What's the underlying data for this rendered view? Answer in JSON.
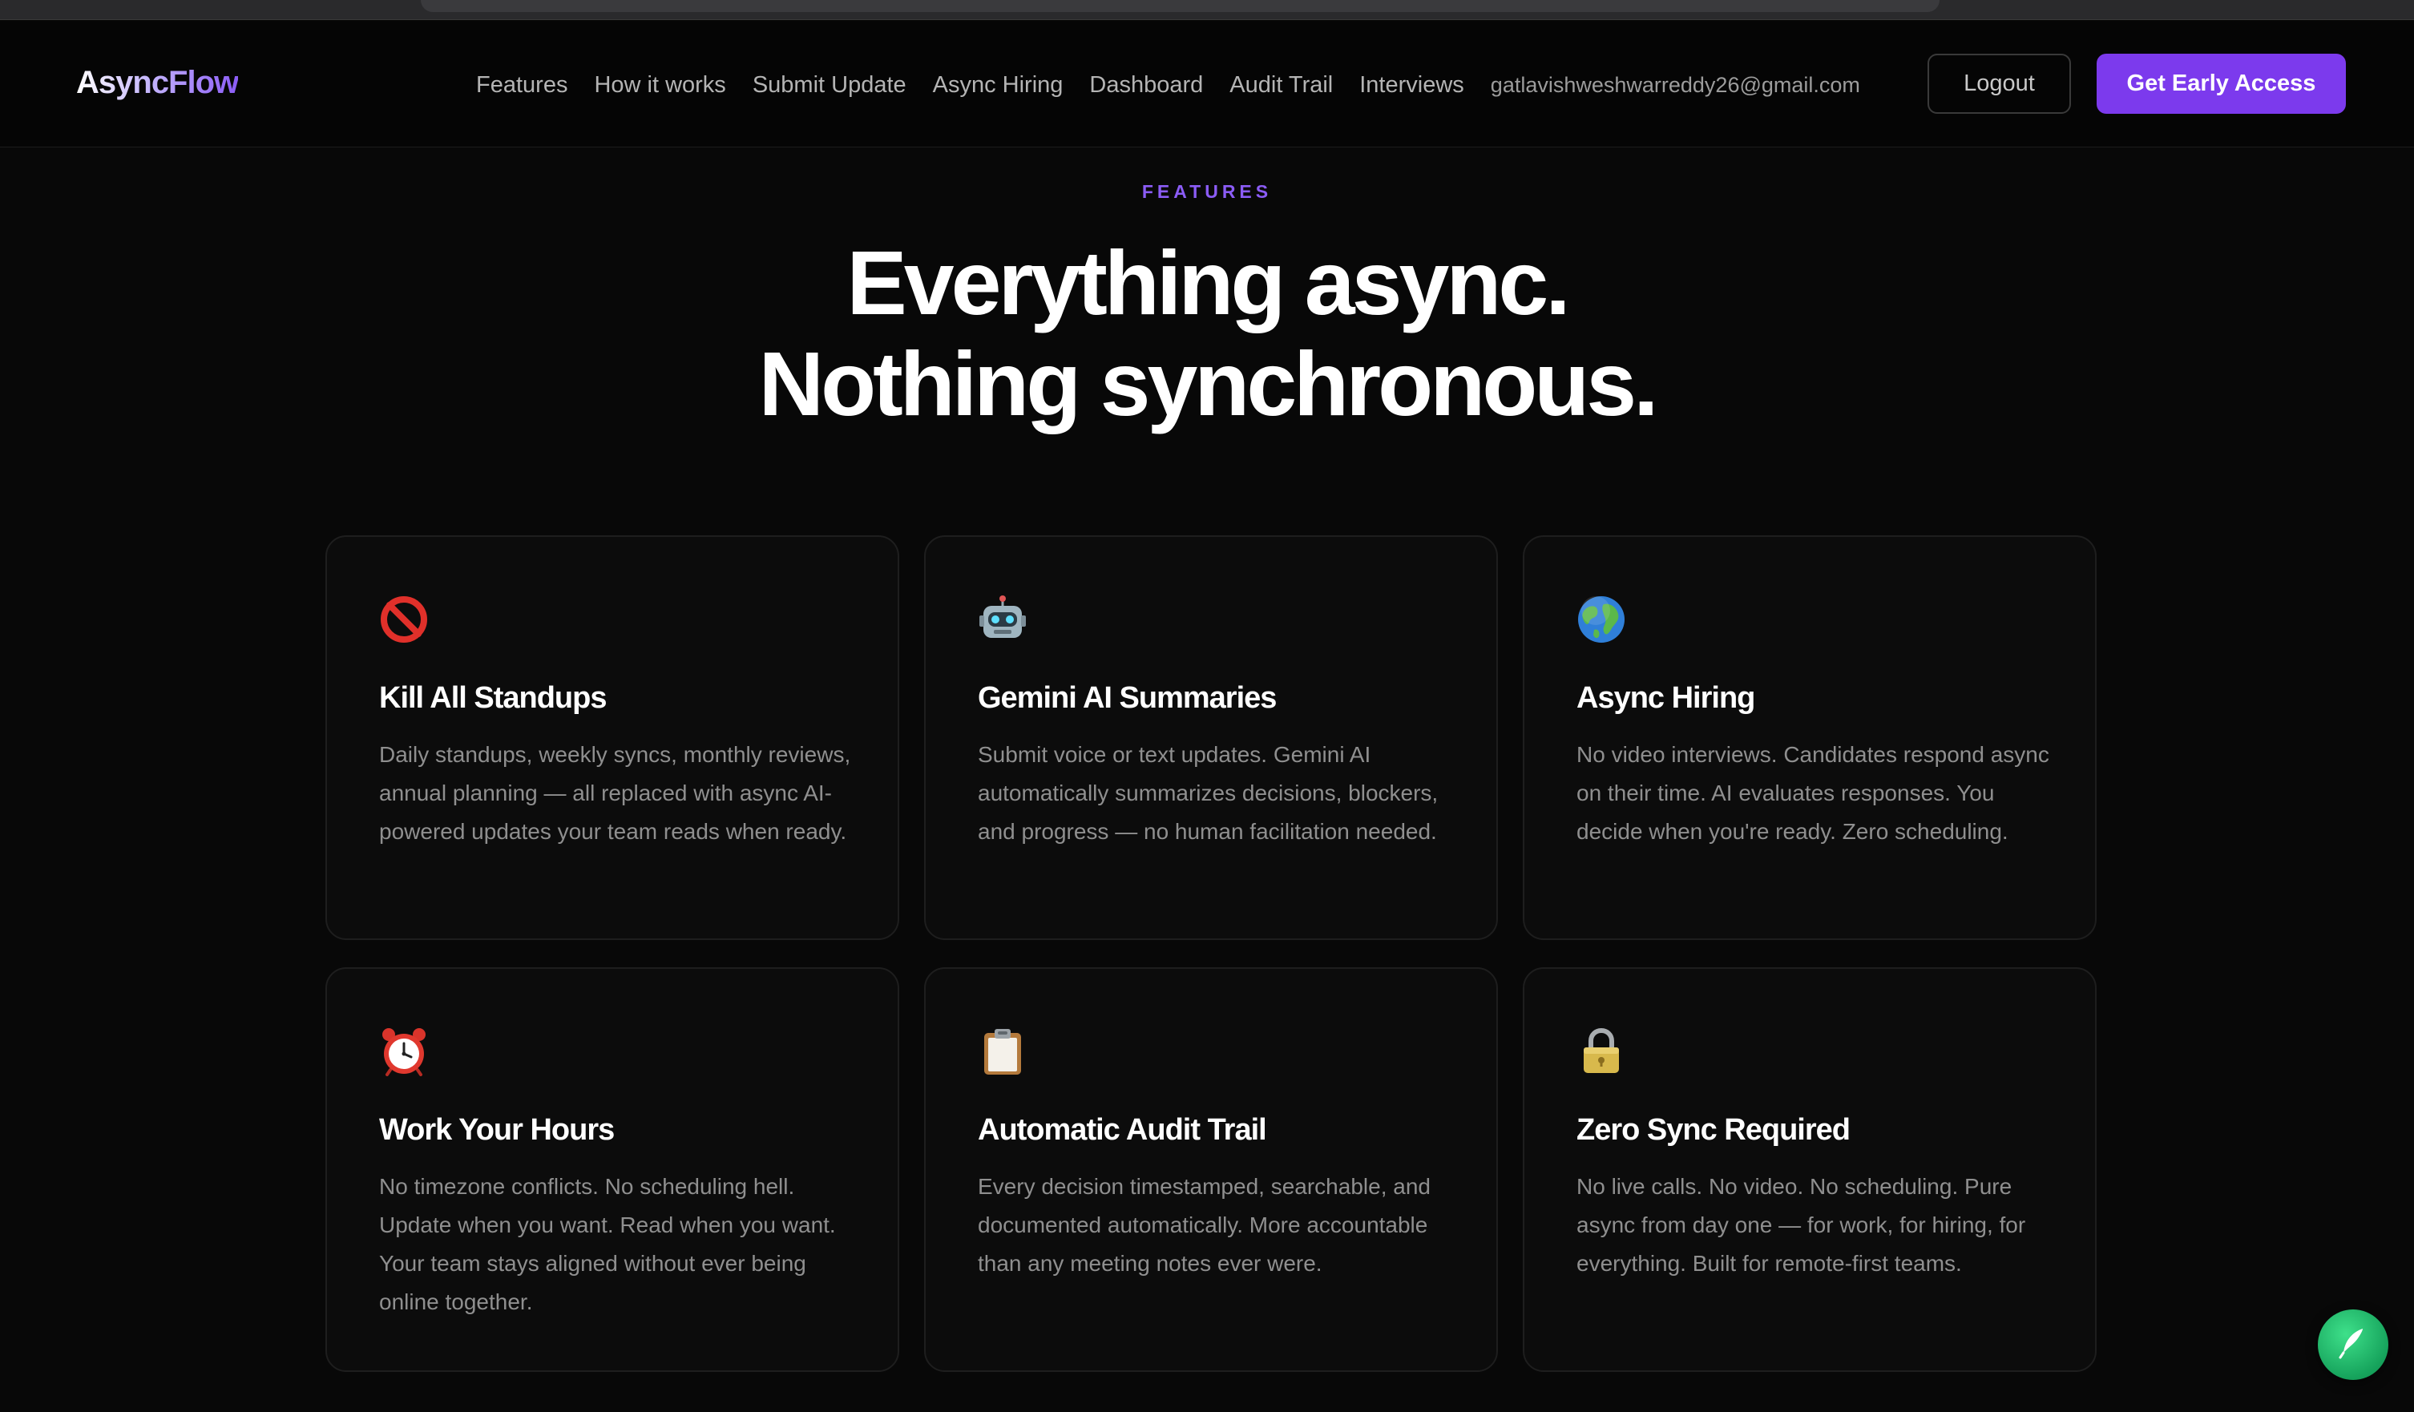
{
  "nav": {
    "logo": "AsyncFlow",
    "links": [
      "Features",
      "How it works",
      "Submit Update",
      "Async Hiring",
      "Dashboard",
      "Audit Trail",
      "Interviews"
    ],
    "email": "gatlavishweshwarreddy26@gmail.com",
    "logout_label": "Logout",
    "cta_label": "Get Early Access"
  },
  "hero": {
    "eyebrow": "FEATURES",
    "headline_line1": "Everything async.",
    "headline_line2": "Nothing synchronous."
  },
  "colors": {
    "accent": "#7c3aed",
    "eyebrow": "#8b5cf6",
    "background": "#080808",
    "card_bg": "#0c0c0c"
  },
  "features": [
    {
      "icon": "prohibited-icon",
      "title": "Kill All Standups",
      "description": "Daily standups, weekly syncs, monthly reviews, annual planning — all replaced with async AI-powered updates your team reads when ready."
    },
    {
      "icon": "robot-icon",
      "title": "Gemini AI Summaries",
      "description": "Submit voice or text updates. Gemini AI automatically summarizes decisions, blockers, and progress — no human facilitation needed."
    },
    {
      "icon": "globe-icon",
      "title": "Async Hiring",
      "description": "No video interviews. Candidates respond async on their time. AI evaluates responses. You decide when you're ready. Zero scheduling."
    },
    {
      "icon": "alarm-clock-icon",
      "title": "Work Your Hours",
      "description": "No timezone conflicts. No scheduling hell. Update when you want. Read when you want. Your team stays aligned without ever being online together."
    },
    {
      "icon": "clipboard-icon",
      "title": "Automatic Audit Trail",
      "description": "Every decision timestamped, searchable, and documented automatically. More accountable than any meeting notes ever were."
    },
    {
      "icon": "lock-icon",
      "title": "Zero Sync Required",
      "description": "No live calls. No video. No scheduling. Pure async from day one — for work, for hiring, for everything. Built for remote-first teams."
    }
  ],
  "fab": {
    "icon": "feather-icon"
  }
}
